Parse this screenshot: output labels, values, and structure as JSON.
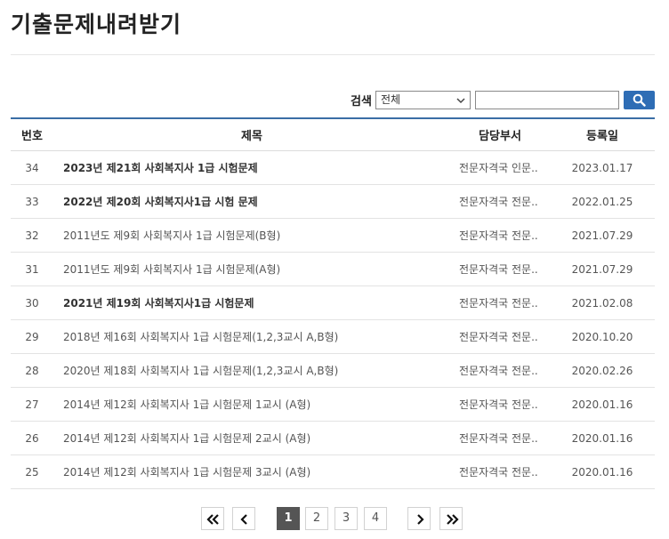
{
  "page": {
    "title": "기출문제내려받기"
  },
  "search": {
    "label": "검색",
    "selected_option": "전체",
    "input_value": "",
    "input_placeholder": "",
    "button_icon": "search-icon",
    "accent_color": "#2e6db5"
  },
  "table": {
    "columns": [
      "번호",
      "제목",
      "담당부서",
      "등록일"
    ],
    "rows": [
      {
        "no": "34",
        "title": "2023년 제21회 사회복지사 1급 시험문제",
        "dept": "전문자격국 인문..",
        "date": "2023.01.17",
        "bold": true
      },
      {
        "no": "33",
        "title": "2022년 제20회 사회복지사1급 시험 문제",
        "dept": "전문자격국 전문..",
        "date": "2022.01.25",
        "bold": true
      },
      {
        "no": "32",
        "title": "2011년도 제9회 사회복지사 1급 시험문제(B형)",
        "dept": "전문자격국 전문..",
        "date": "2021.07.29",
        "bold": false
      },
      {
        "no": "31",
        "title": "2011년도 제9회 사회복지사 1급 시험문제(A형)",
        "dept": "전문자격국 전문..",
        "date": "2021.07.29",
        "bold": false
      },
      {
        "no": "30",
        "title": "2021년 제19회 사회복지사1급 시험문제",
        "dept": "전문자격국 전문..",
        "date": "2021.02.08",
        "bold": true
      },
      {
        "no": "29",
        "title": "2018년 제16회 사회복지사 1급 시험문제(1,2,3교시 A,B형)",
        "dept": "전문자격국 전문..",
        "date": "2020.10.20",
        "bold": false
      },
      {
        "no": "28",
        "title": "2020년 제18회 사회복지사 1급 시험문제(1,2,3교시 A,B형)",
        "dept": "전문자격국 전문..",
        "date": "2020.02.26",
        "bold": false
      },
      {
        "no": "27",
        "title": "2014년 제12회 사회복지사 1급 시험문제 1교시 (A형)",
        "dept": "전문자격국 전문..",
        "date": "2020.01.16",
        "bold": false
      },
      {
        "no": "26",
        "title": "2014년 제12회 사회복지사 1급 시험문제 2교시 (A형)",
        "dept": "전문자격국 전문..",
        "date": "2020.01.16",
        "bold": false
      },
      {
        "no": "25",
        "title": "2014년 제12회 사회복지사 1급 시험문제 3교시 (A형)",
        "dept": "전문자격국 전문..",
        "date": "2020.01.16",
        "bold": false
      }
    ]
  },
  "pagination": {
    "first_icon": "double-chevron-left-icon",
    "prev_icon": "chevron-left-icon",
    "pages": [
      "1",
      "2",
      "3",
      "4"
    ],
    "current_page": "1",
    "next_icon": "chevron-right-icon",
    "last_icon": "double-chevron-right-icon"
  }
}
